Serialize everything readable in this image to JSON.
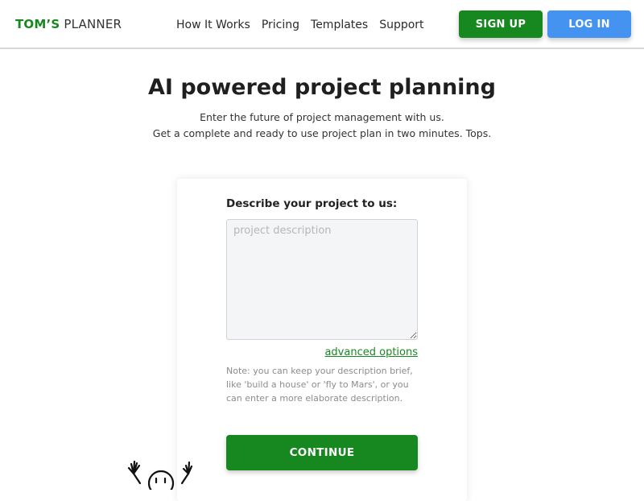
{
  "header": {
    "logo_strong": "TOM’S",
    "logo_light": "PLANNER",
    "nav": [
      "How It Works",
      "Pricing",
      "Templates",
      "Support"
    ],
    "signup_label": "SIGN UP",
    "login_label": "LOG IN"
  },
  "hero": {
    "title": "AI powered project planning",
    "subtitle_line1": "Enter the future of project management with us.",
    "subtitle_line2": "Get a complete and ready to use project plan in two minutes. Tops."
  },
  "form": {
    "label": "Describe your project to us:",
    "description_placeholder": "project description",
    "description_value": "",
    "advanced_link": "advanced options",
    "note": "Note: you can keep your description brief, like 'build a house' or 'fly to Mars', or you can enter a more elaborate description.",
    "continue_label": "CONTINUE"
  },
  "colors": {
    "brand_green": "#17881f",
    "login_blue": "#4493f0"
  },
  "icons": {
    "mascot": "waving-smiley-doodle-icon"
  }
}
